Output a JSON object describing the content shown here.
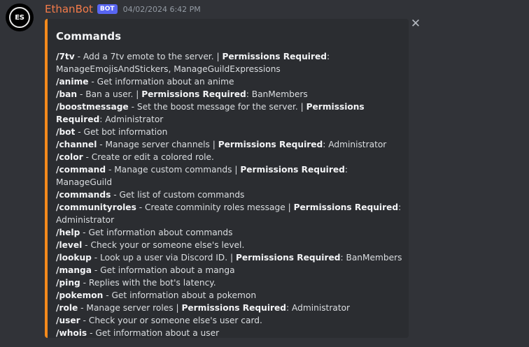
{
  "message": {
    "avatar_text": "ES",
    "username": "EthanBot",
    "bot_tag": "BOT",
    "timestamp": "04/02/2024 6:42 PM"
  },
  "embed": {
    "accent_color": "#f48a1c",
    "title": "Commands",
    "close_icon": "close-icon",
    "commands": [
      {
        "name": "/7tv",
        "desc": " - Add a 7tv emote to the server. | ",
        "perm_label": "Permissions Required",
        "perm_value": ": ManageEmojisAndStickers, ManageGuildExpressions"
      },
      {
        "name": "/anime",
        "desc": " - Get information about an anime",
        "perm_label": "",
        "perm_value": ""
      },
      {
        "name": "/ban",
        "desc": " - Ban a user. | ",
        "perm_label": "Permissions Required",
        "perm_value": ": BanMembers"
      },
      {
        "name": "/boostmessage",
        "desc": " - Set the boost message for the server. | ",
        "perm_label": "Permissions Required",
        "perm_value": ": Administrator"
      },
      {
        "name": "/bot",
        "desc": " - Get bot information",
        "perm_label": "",
        "perm_value": ""
      },
      {
        "name": "/channel",
        "desc": " - Manage server channels | ",
        "perm_label": "Permissions Required",
        "perm_value": ": Administrator"
      },
      {
        "name": "/color",
        "desc": " - Create or edit a colored role.",
        "perm_label": "",
        "perm_value": ""
      },
      {
        "name": "/command",
        "desc": " - Manage custom commands | ",
        "perm_label": "Permissions Required",
        "perm_value": ": ManageGuild"
      },
      {
        "name": "/commands",
        "desc": " - Get list of custom commands",
        "perm_label": "",
        "perm_value": ""
      },
      {
        "name": "/communityroles",
        "desc": " - Create comminity roles message | ",
        "perm_label": "Permissions Required",
        "perm_value": ": Administrator"
      },
      {
        "name": "/help",
        "desc": " - Get information about commands",
        "perm_label": "",
        "perm_value": ""
      },
      {
        "name": "/level",
        "desc": " - Check your or someone else's level.",
        "perm_label": "",
        "perm_value": ""
      },
      {
        "name": "/lookup",
        "desc": " - Look up a user via Discord ID. | ",
        "perm_label": "Permissions Required",
        "perm_value": ": BanMembers"
      },
      {
        "name": "/manga",
        "desc": " - Get information about a manga",
        "perm_label": "",
        "perm_value": ""
      },
      {
        "name": "/ping",
        "desc": " - Replies with the bot's latency.",
        "perm_label": "",
        "perm_value": ""
      },
      {
        "name": "/pokemon",
        "desc": " - Get information about a pokemon",
        "perm_label": "",
        "perm_value": ""
      },
      {
        "name": "/role",
        "desc": " - Manage server roles | ",
        "perm_label": "Permissions Required",
        "perm_value": ": Administrator"
      },
      {
        "name": "/user",
        "desc": " - Check your or someone else's user card.",
        "perm_label": "",
        "perm_value": ""
      },
      {
        "name": "/whois",
        "desc": " - Get information about a user",
        "perm_label": "",
        "perm_value": ""
      }
    ]
  }
}
